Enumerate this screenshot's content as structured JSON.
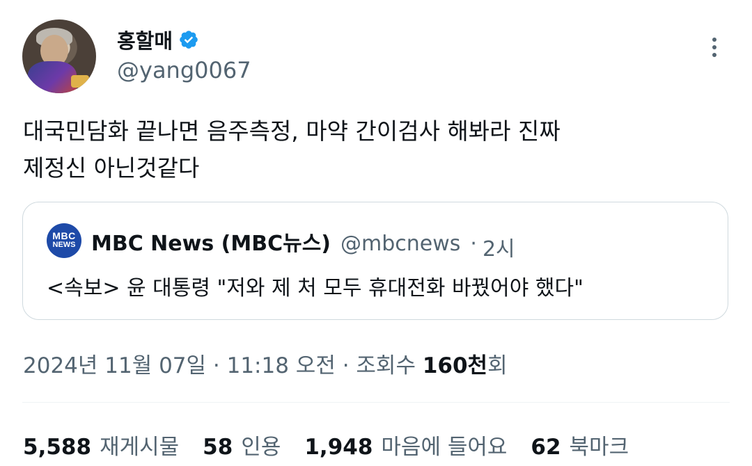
{
  "author": {
    "display_name": "홍할매",
    "handle": "@yang0067",
    "verified_icon": "verified-badge-icon"
  },
  "tweet": {
    "lines": [
      "대국민담화 끝나면 음주측정, 마약 간이검사 해봐라 진짜",
      "제정신 아닌것같다"
    ]
  },
  "quote": {
    "logo_line1": "MBC",
    "logo_line2": "NEWS",
    "name": "MBC News (MBC뉴스)",
    "handle": "@mbcnews",
    "dot": "·",
    "time": "2시",
    "text": "<속보> 윤 대통령 \"저와 제 처 모두 휴대전화 바꿨어야 했다\""
  },
  "meta": {
    "datetime": "2024년 11월 07일 · 11:18 오전 · 조회수 ",
    "views_num": "160천",
    "views_suffix": "회"
  },
  "stats": [
    {
      "num": "5,588",
      "label": "재게시물"
    },
    {
      "num": "58",
      "label": "인용"
    },
    {
      "num": "1,948",
      "label": "마음에 들어요"
    },
    {
      "num": "62",
      "label": "북마크"
    }
  ],
  "colors": {
    "text": "#0f1419",
    "secondary": "#536471",
    "verified": "#1d9bf0",
    "border": "#cfd9de",
    "mbc_blue": "#1e4aa8"
  }
}
